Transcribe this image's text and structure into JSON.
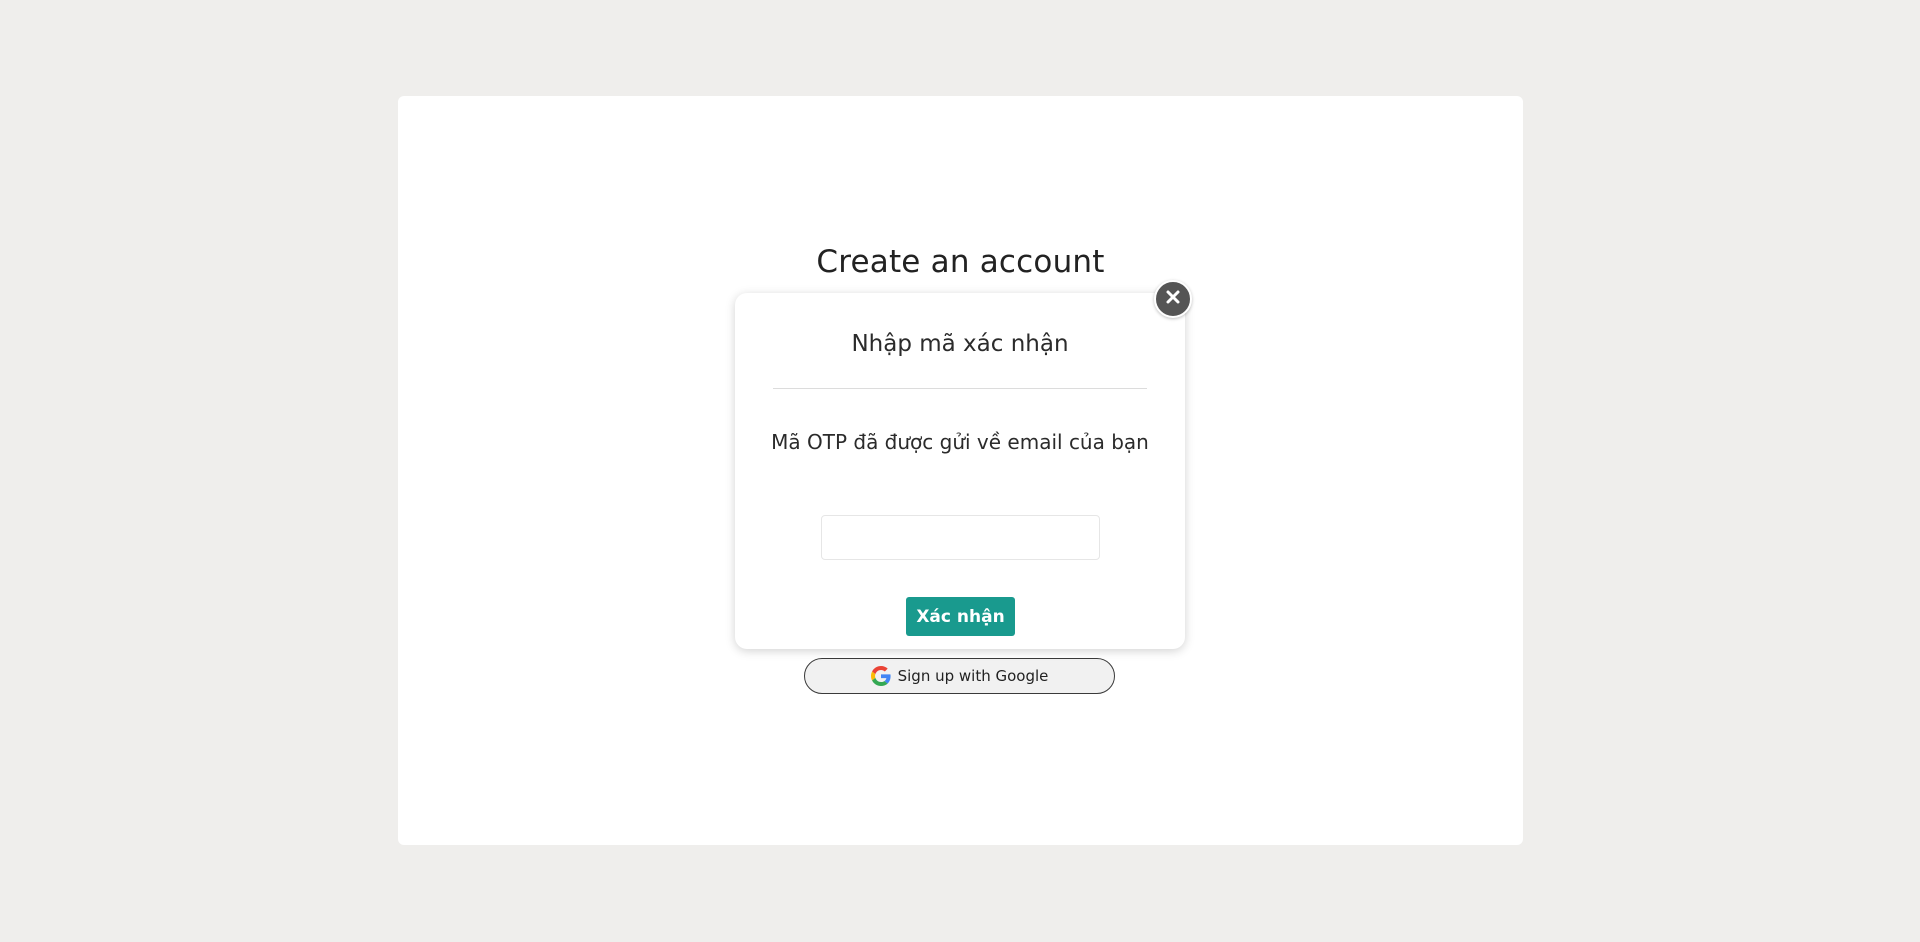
{
  "signup": {
    "title": "Create an account",
    "google_button_label": "Sign up with Google",
    "google_icon": "google-icon"
  },
  "otp_modal": {
    "title": "Nhập mã xác nhận",
    "message": "Mã OTP đã được gửi về email của bạn",
    "input_value": "",
    "input_placeholder": "",
    "confirm_label": "Xác nhận",
    "close_icon": "close-icon"
  },
  "colors": {
    "background": "#efeeec",
    "card": "#ffffff",
    "accent": "#199a8e",
    "close_button": "#555555"
  }
}
